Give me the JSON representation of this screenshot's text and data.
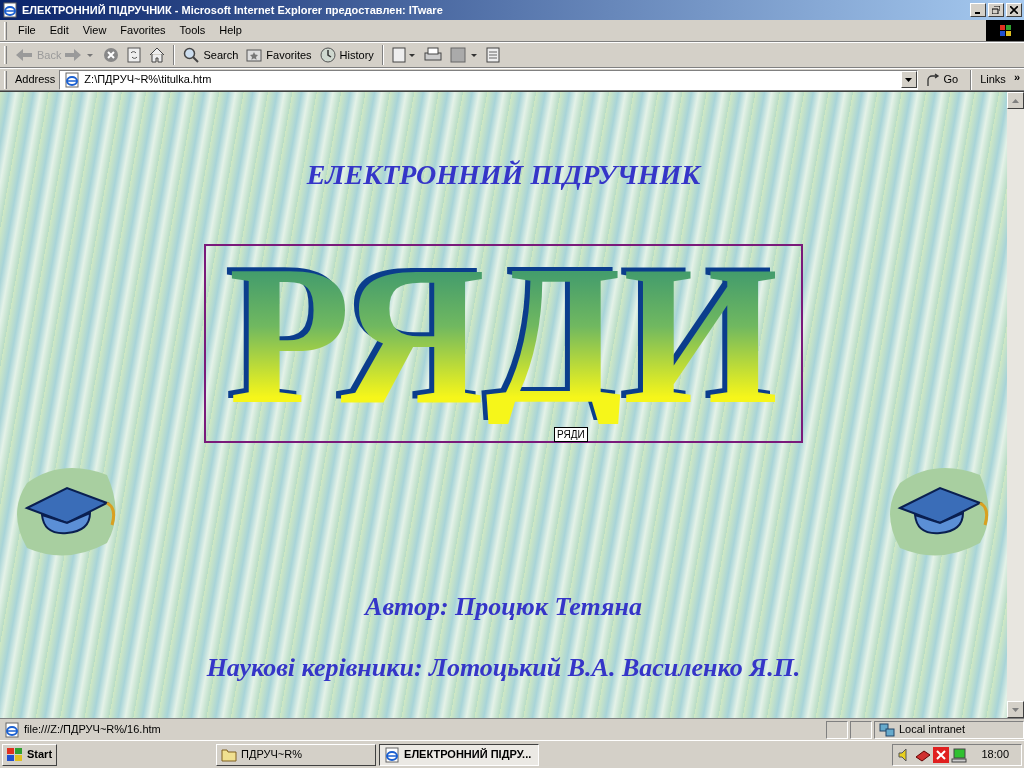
{
  "window": {
    "title": "ЕЛЕКТРОННИЙ ПІДРУЧНИК - Microsoft Internet Explorer предоставлен: ITware"
  },
  "menu": [
    "File",
    "Edit",
    "View",
    "Favorites",
    "Tools",
    "Help"
  ],
  "toolbar": [
    {
      "kind": "back",
      "label": "Back",
      "disabled": true
    },
    {
      "kind": "search",
      "label": "Search",
      "disabled": false
    },
    {
      "kind": "favorites",
      "label": "Favorites",
      "disabled": false
    },
    {
      "kind": "history",
      "label": "History",
      "disabled": false
    }
  ],
  "address_bar": {
    "label": "Address",
    "value": "Z:\\ПДРУЧ~R%\\titulka.htm",
    "go": "Go",
    "links": "Links",
    "more": "»"
  },
  "page": {
    "heading": "ЕЛЕКТРОННИЙ ПІДРУЧНИК",
    "wordart": "РЯДИ",
    "tooltip": "РЯДИ",
    "author": "Автор: Процюк Тетяна",
    "advisors": "Наукові керівники: Лотоцький В.А. Василенко Я.П."
  },
  "status_bar": {
    "text": "file:///Z:/ПДРУЧ~R%/16.htm",
    "zone": "Local intranet"
  },
  "taskbar": {
    "start": "Start",
    "tasks": [
      {
        "label": "ПДРУЧ~R%",
        "kind": "folder",
        "selected": false
      },
      {
        "label": "ЕЛЕКТРОННИЙ ПІДРУ...",
        "kind": "browser",
        "selected": true
      }
    ],
    "clock": "18:00"
  }
}
